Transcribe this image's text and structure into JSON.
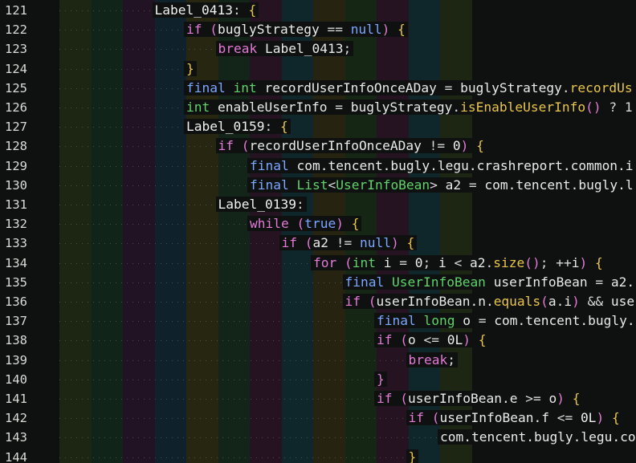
{
  "editor": {
    "theme_colors": {
      "background": "#0f1010",
      "keyword": "#e47ad8",
      "type": "#5fd36a",
      "function": "#e9c64a",
      "literal": "#7aa7ff",
      "text": "#eaeaea",
      "line_number": "#d8dcd8"
    },
    "indent_band_colors": [
      "#1f2a14",
      "#12281c",
      "#241428",
      "#0f2430",
      "#2a2a12",
      "#14281a",
      "#2a1426",
      "#0f2a30",
      "#2a2812",
      "#162a16",
      "#2a1426",
      "#0f2a30"
    ],
    "lines": [
      {
        "num": "121",
        "indent": 3,
        "tokens": [
          [
            "tok-label",
            "Label_0413"
          ],
          [
            "tok-op",
            ": "
          ],
          [
            "tok-brace",
            "{"
          ]
        ]
      },
      {
        "num": "122",
        "indent": 4,
        "tokens": [
          [
            "tok-kw",
            "if"
          ],
          [
            "tok-op",
            " "
          ],
          [
            "tok-paren",
            "("
          ],
          [
            "tok-id",
            "buglyStrategy"
          ],
          [
            "tok-op",
            " == "
          ],
          [
            "tok-lit",
            "null"
          ],
          [
            "tok-paren",
            ")"
          ],
          [
            "tok-op",
            " "
          ],
          [
            "tok-brace",
            "{"
          ]
        ]
      },
      {
        "num": "123",
        "indent": 5,
        "tokens": [
          [
            "tok-kw",
            "break"
          ],
          [
            "tok-op",
            " "
          ],
          [
            "tok-id",
            "Label_0413"
          ],
          [
            "tok-op",
            ";"
          ]
        ]
      },
      {
        "num": "124",
        "indent": 4,
        "tokens": [
          [
            "tok-brace",
            "}"
          ]
        ]
      },
      {
        "num": "125",
        "indent": 4,
        "tokens": [
          [
            "tok-lit",
            "final"
          ],
          [
            "tok-op",
            " "
          ],
          [
            "tok-type",
            "int"
          ],
          [
            "tok-op",
            " "
          ],
          [
            "tok-id",
            "recordUserInfoOnceADay"
          ],
          [
            "tok-op",
            " = "
          ],
          [
            "tok-id",
            "buglyStrategy"
          ],
          [
            "tok-op",
            "."
          ],
          [
            "tok-fn",
            "recordUs"
          ]
        ]
      },
      {
        "num": "126",
        "indent": 4,
        "tokens": [
          [
            "tok-type",
            "int"
          ],
          [
            "tok-op",
            " "
          ],
          [
            "tok-id",
            "enableUserInfo"
          ],
          [
            "tok-op",
            " = "
          ],
          [
            "tok-id",
            "buglyStrategy"
          ],
          [
            "tok-op",
            "."
          ],
          [
            "tok-fn",
            "isEnableUserInfo"
          ],
          [
            "tok-paren",
            "()"
          ],
          [
            "tok-op",
            " ? 1"
          ]
        ]
      },
      {
        "num": "127",
        "indent": 4,
        "tokens": [
          [
            "tok-label",
            "Label_0159"
          ],
          [
            "tok-op",
            ": "
          ],
          [
            "tok-brace",
            "{"
          ]
        ]
      },
      {
        "num": "128",
        "indent": 5,
        "tokens": [
          [
            "tok-kw",
            "if"
          ],
          [
            "tok-op",
            " "
          ],
          [
            "tok-paren",
            "("
          ],
          [
            "tok-id",
            "recordUserInfoOnceADay"
          ],
          [
            "tok-op",
            " != "
          ],
          [
            "tok-num",
            "0"
          ],
          [
            "tok-paren",
            ")"
          ],
          [
            "tok-op",
            " "
          ],
          [
            "tok-brace",
            "{"
          ]
        ]
      },
      {
        "num": "129",
        "indent": 6,
        "tokens": [
          [
            "tok-lit",
            "final"
          ],
          [
            "tok-op",
            " "
          ],
          [
            "tok-id",
            "com.tencent.bugly.legu.crashreport.common.i"
          ]
        ]
      },
      {
        "num": "130",
        "indent": 6,
        "tokens": [
          [
            "tok-lit",
            "final"
          ],
          [
            "tok-op",
            " "
          ],
          [
            "tok-type",
            "List"
          ],
          [
            "tok-op",
            "<"
          ],
          [
            "tok-type",
            "UserInfoBean"
          ],
          [
            "tok-op",
            "> "
          ],
          [
            "tok-id",
            "a2"
          ],
          [
            "tok-op",
            " = "
          ],
          [
            "tok-id",
            "com.tencent.bugly.l"
          ]
        ]
      },
      {
        "num": "131",
        "indent": 5,
        "tokens": [
          [
            "tok-label",
            "Label_0139"
          ],
          [
            "tok-op",
            ":"
          ]
        ]
      },
      {
        "num": "132",
        "indent": 6,
        "tokens": [
          [
            "tok-kw",
            "while"
          ],
          [
            "tok-op",
            " "
          ],
          [
            "tok-paren",
            "("
          ],
          [
            "tok-lit",
            "true"
          ],
          [
            "tok-paren",
            ")"
          ],
          [
            "tok-op",
            " "
          ],
          [
            "tok-brace",
            "{"
          ]
        ]
      },
      {
        "num": "133",
        "indent": 7,
        "tokens": [
          [
            "tok-kw",
            "if"
          ],
          [
            "tok-op",
            " "
          ],
          [
            "tok-paren",
            "("
          ],
          [
            "tok-id",
            "a2"
          ],
          [
            "tok-op",
            " != "
          ],
          [
            "tok-lit",
            "null"
          ],
          [
            "tok-paren",
            ")"
          ],
          [
            "tok-op",
            " "
          ],
          [
            "tok-brace",
            "{"
          ]
        ]
      },
      {
        "num": "134",
        "indent": 8,
        "tokens": [
          [
            "tok-kw",
            "for"
          ],
          [
            "tok-op",
            " "
          ],
          [
            "tok-paren",
            "("
          ],
          [
            "tok-type",
            "int"
          ],
          [
            "tok-op",
            " "
          ],
          [
            "tok-id",
            "i"
          ],
          [
            "tok-op",
            " = "
          ],
          [
            "tok-num",
            "0"
          ],
          [
            "tok-op",
            "; "
          ],
          [
            "tok-id",
            "i"
          ],
          [
            "tok-op",
            " < "
          ],
          [
            "tok-id",
            "a2"
          ],
          [
            "tok-op",
            "."
          ],
          [
            "tok-fn",
            "size"
          ],
          [
            "tok-paren",
            "()"
          ],
          [
            "tok-op",
            "; ++"
          ],
          [
            "tok-id",
            "i"
          ],
          [
            "tok-paren",
            ")"
          ],
          [
            "tok-op",
            " "
          ],
          [
            "tok-brace",
            "{"
          ]
        ]
      },
      {
        "num": "135",
        "indent": 9,
        "tokens": [
          [
            "tok-lit",
            "final"
          ],
          [
            "tok-op",
            " "
          ],
          [
            "tok-type",
            "UserInfoBean"
          ],
          [
            "tok-op",
            " "
          ],
          [
            "tok-id",
            "userInfoBean"
          ],
          [
            "tok-op",
            " = "
          ],
          [
            "tok-id",
            "a2."
          ]
        ]
      },
      {
        "num": "136",
        "indent": 9,
        "tokens": [
          [
            "tok-kw",
            "if"
          ],
          [
            "tok-op",
            " "
          ],
          [
            "tok-paren",
            "("
          ],
          [
            "tok-id",
            "userInfoBean.n."
          ],
          [
            "tok-fn",
            "equals"
          ],
          [
            "tok-paren",
            "("
          ],
          [
            "tok-id",
            "a.i"
          ],
          [
            "tok-paren",
            ")"
          ],
          [
            "tok-op",
            " && "
          ],
          [
            "tok-id",
            "use"
          ]
        ]
      },
      {
        "num": "137",
        "indent": 10,
        "tokens": [
          [
            "tok-lit",
            "final"
          ],
          [
            "tok-op",
            " "
          ],
          [
            "tok-type",
            "long"
          ],
          [
            "tok-op",
            " "
          ],
          [
            "tok-id",
            "o"
          ],
          [
            "tok-op",
            " = "
          ],
          [
            "tok-id",
            "com.tencent.bugly."
          ]
        ]
      },
      {
        "num": "138",
        "indent": 10,
        "tokens": [
          [
            "tok-kw",
            "if"
          ],
          [
            "tok-op",
            " "
          ],
          [
            "tok-paren",
            "("
          ],
          [
            "tok-id",
            "o"
          ],
          [
            "tok-op",
            " <= "
          ],
          [
            "tok-num",
            "0L"
          ],
          [
            "tok-paren",
            ")"
          ],
          [
            "tok-op",
            " "
          ],
          [
            "tok-brace",
            "{"
          ]
        ]
      },
      {
        "num": "139",
        "indent": 11,
        "tokens": [
          [
            "tok-kw",
            "break"
          ],
          [
            "tok-op",
            ";"
          ]
        ]
      },
      {
        "num": "140",
        "indent": 10,
        "tokens": [
          [
            "tok-kw",
            "}"
          ]
        ]
      },
      {
        "num": "141",
        "indent": 10,
        "tokens": [
          [
            "tok-kw",
            "if"
          ],
          [
            "tok-op",
            " "
          ],
          [
            "tok-paren",
            "("
          ],
          [
            "tok-id",
            "userInfoBean.e"
          ],
          [
            "tok-op",
            " >= "
          ],
          [
            "tok-id",
            "o"
          ],
          [
            "tok-paren",
            ")"
          ],
          [
            "tok-op",
            " "
          ],
          [
            "tok-brace",
            "{"
          ]
        ]
      },
      {
        "num": "142",
        "indent": 11,
        "tokens": [
          [
            "tok-kw",
            "if"
          ],
          [
            "tok-op",
            " "
          ],
          [
            "tok-paren",
            "("
          ],
          [
            "tok-id",
            "userInfoBean.f"
          ],
          [
            "tok-op",
            " <= "
          ],
          [
            "tok-num",
            "0L"
          ],
          [
            "tok-paren",
            ")"
          ],
          [
            "tok-op",
            " "
          ],
          [
            "tok-brace",
            "{"
          ]
        ]
      },
      {
        "num": "143",
        "indent": 12,
        "tokens": [
          [
            "tok-id",
            "com.tencent.bugly.legu.co"
          ]
        ]
      },
      {
        "num": "144",
        "indent": 11,
        "tokens": [
          [
            "tok-brace",
            "}"
          ]
        ]
      }
    ]
  }
}
